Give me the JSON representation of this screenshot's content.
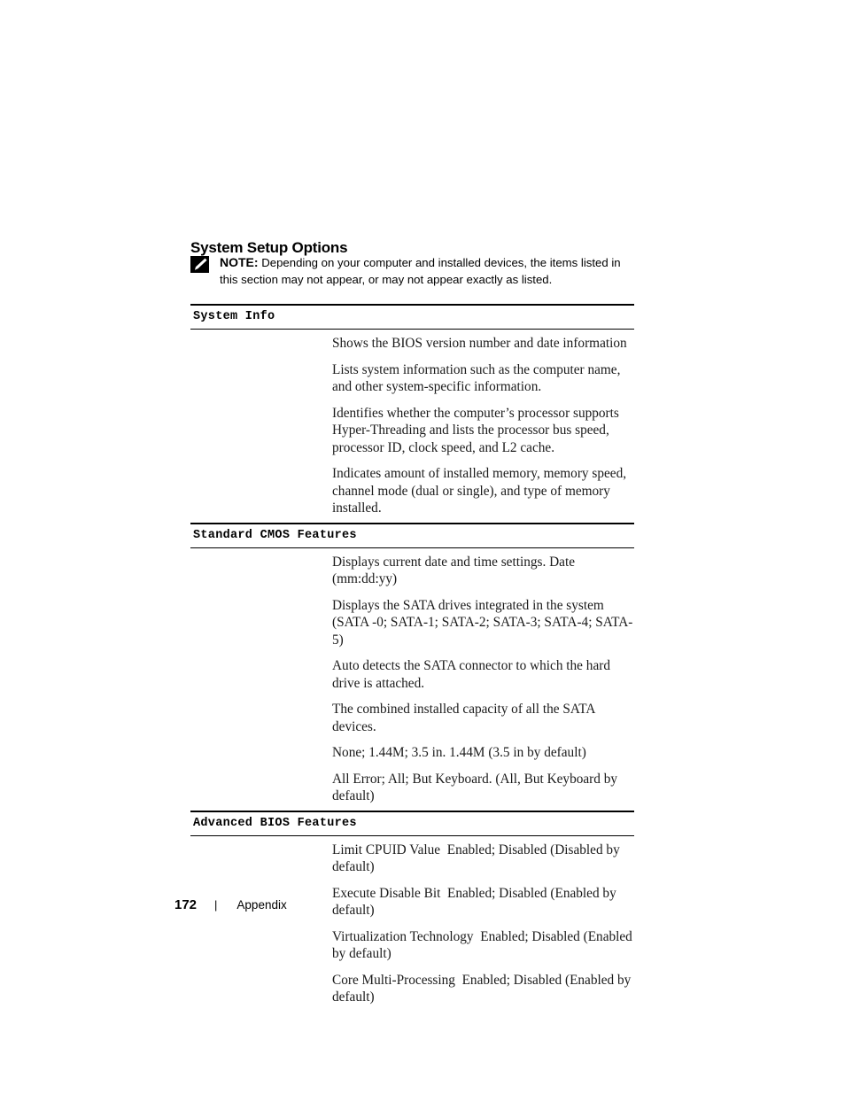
{
  "heading": "System Setup Options",
  "note": {
    "icon": "pencil-note-icon",
    "label": "NOTE:",
    "text": " Depending on your computer and installed devices, the items listed in this section may not appear, or may not appear exactly as listed."
  },
  "table": {
    "groups": [
      {
        "header": "System Info",
        "rows": [
          {
            "name": "",
            "desc": "Shows the BIOS version number and date information"
          },
          {
            "name": "",
            "desc": "Lists system information such as the computer name, and other system-specific information."
          },
          {
            "name": "",
            "desc": "Identifies whether the computer’s processor supports Hyper-Threading and lists the processor bus speed, processor ID, clock speed, and L2 cache."
          },
          {
            "name": "",
            "desc": "Indicates amount of installed memory, memory speed, channel mode (dual or single), and type of memory installed."
          }
        ]
      },
      {
        "header": "Standard CMOS Features",
        "rows": [
          {
            "name": "",
            "desc": "Displays current date and time settings. Date (mm:dd:yy)"
          },
          {
            "name": "",
            "desc": "Displays the SATA drives integrated in the system (SATA -0; SATA-1; SATA-2; SATA-3; SATA-4; SATA-5)"
          },
          {
            "name": "",
            "desc": "Auto detects the SATA connector to which the hard drive is attached."
          },
          {
            "name": "",
            "desc": "The combined installed capacity of all the SATA devices."
          },
          {
            "name": "",
            "desc": "None; 1.44M; 3.5 in. 1.44M (3.5 in by default)"
          },
          {
            "name": "",
            "desc": "All Error; All; But Keyboard. (All, But Keyboard by default)"
          }
        ]
      },
      {
        "header": "Advanced BIOS Features",
        "rows": [
          {
            "name": "",
            "desc": "Limit CPUID Value  Enabled; Disabled (Disabled by default)"
          },
          {
            "name": "",
            "desc": "Execute Disable Bit  Enabled; Disabled (Enabled by default)"
          },
          {
            "name": "",
            "desc": "Virtualization Technology  Enabled; Disabled (Enabled by default)"
          },
          {
            "name": "",
            "desc": "Core Multi-Processing  Enabled; Disabled (Enabled by default)"
          }
        ]
      }
    ]
  },
  "footer": {
    "page_number": "172",
    "separator": "|",
    "label": "Appendix"
  }
}
